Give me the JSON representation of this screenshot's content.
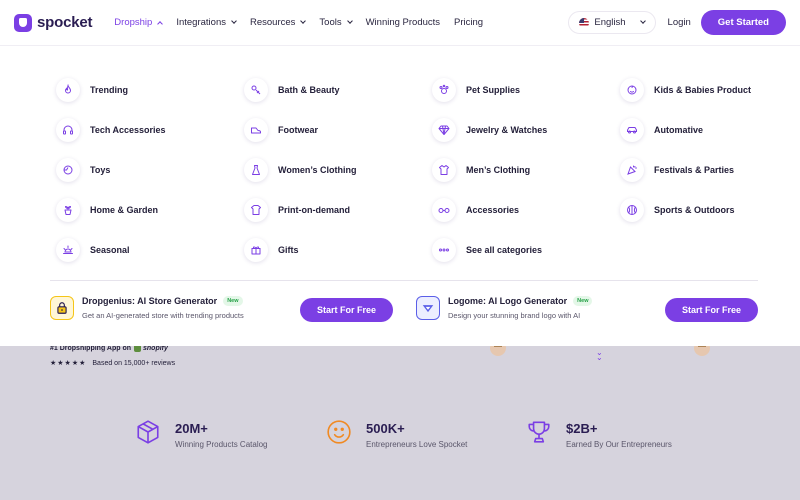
{
  "header": {
    "brand": "spocket",
    "nav": [
      {
        "label": "Dropship",
        "has_chevron": true,
        "active": true
      },
      {
        "label": "Integrations",
        "has_chevron": true
      },
      {
        "label": "Resources",
        "has_chevron": true
      },
      {
        "label": "Tools",
        "has_chevron": true
      },
      {
        "label": "Winning Products",
        "has_chevron": false
      },
      {
        "label": "Pricing",
        "has_chevron": false
      }
    ],
    "language": "English",
    "login": "Login",
    "cta": "Get Started"
  },
  "dropdown": {
    "categories": [
      {
        "label": "Trending",
        "icon": "flame-icon"
      },
      {
        "label": "Bath & Beauty",
        "icon": "beauty-icon"
      },
      {
        "label": "Pet Supplies",
        "icon": "paw-icon"
      },
      {
        "label": "Kids & Babies Product",
        "icon": "baby-icon"
      },
      {
        "label": "Tech Accessories",
        "icon": "headphones-icon"
      },
      {
        "label": "Footwear",
        "icon": "shoe-icon"
      },
      {
        "label": "Jewelry & Watches",
        "icon": "diamond-icon"
      },
      {
        "label": "Automative",
        "icon": "car-icon"
      },
      {
        "label": "Toys",
        "icon": "toy-icon"
      },
      {
        "label": "Women’s Clothing",
        "icon": "dress-icon"
      },
      {
        "label": "Men’s Clothing",
        "icon": "shirt-icon"
      },
      {
        "label": "Festivals & Parties",
        "icon": "party-icon"
      },
      {
        "label": "Home & Garden",
        "icon": "plant-icon"
      },
      {
        "label": "Print-on-demand",
        "icon": "tshirt-icon"
      },
      {
        "label": "Accessories",
        "icon": "glasses-icon"
      },
      {
        "label": "Sports & Outdoors",
        "icon": "ball-icon"
      },
      {
        "label": "Seasonal",
        "icon": "sun-icon"
      },
      {
        "label": "Gifts",
        "icon": "gift-icon"
      },
      {
        "label": "See all categories",
        "icon": "dots-icon"
      }
    ],
    "promos": [
      {
        "title": "Dropgenius: AI Store Generator",
        "badge": "New",
        "subtitle": "Get an AI-generated store with trending products",
        "button": "Start For Free",
        "icon": "dropgenius-icon",
        "icon_color": "#f5c518"
      },
      {
        "title": "Logome: AI Logo Generator",
        "badge": "New",
        "subtitle": "Design your stunning brand logo with AI",
        "button": "Start For Free",
        "icon": "logome-icon",
        "icon_color": "#5b5fe8"
      }
    ]
  },
  "page": {
    "app_text": "#1 Dropshipping App on",
    "shopify": "shopify",
    "stars": "★★★★★",
    "reviews": "Based on 15,000+ reviews",
    "stats": [
      {
        "value": "20M+",
        "label": "Winning Products Catalog",
        "icon": "box-icon"
      },
      {
        "value": "500K+",
        "label": "Entrepreneurs Love Spocket",
        "icon": "smile-icon"
      },
      {
        "value": "$2B+",
        "label": "Earned By Our Entrepreneurs",
        "icon": "trophy-icon"
      }
    ]
  },
  "colors": {
    "accent": "#7b3fe4",
    "icon_stroke": "#7b3fe4",
    "stat_orange": "#f08a24"
  }
}
